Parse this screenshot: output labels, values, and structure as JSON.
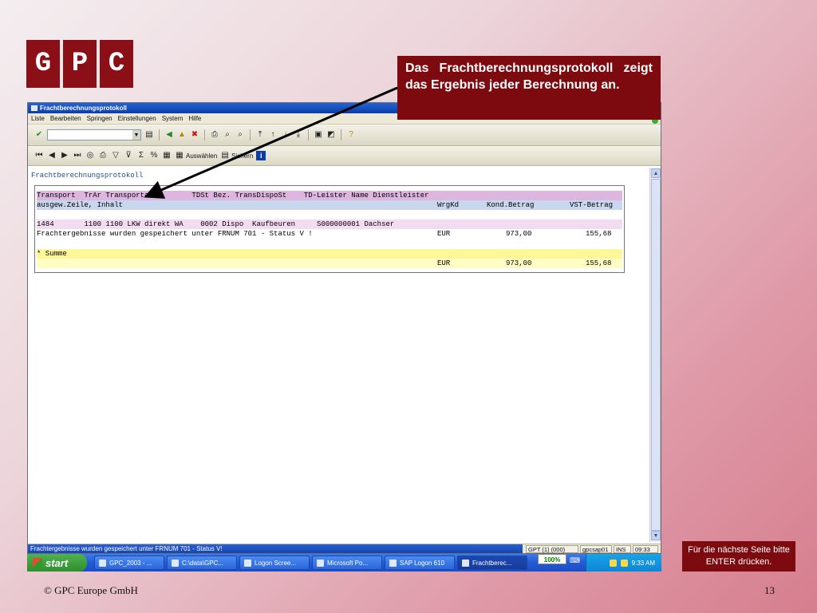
{
  "logo": {
    "letters": [
      "G",
      "P",
      "C"
    ]
  },
  "callout": {
    "text": "Das Frachtberechnungsprotokoll zeigt das Ergebnis jeder Berechnung an."
  },
  "window": {
    "title": "Frachtberechnungsprotokoll",
    "menu": [
      "Liste",
      "Bearbeiten",
      "Springen",
      "Einstellungen",
      "System",
      "Hilfe"
    ],
    "toolbar2": {
      "auswaehlen": "Auswählen",
      "sichern": "Sichern"
    }
  },
  "report": {
    "title": "Frachtberechnungsprotokoll",
    "header": {
      "line1": "Transport  TrAr Transportart        TDSt Bez. TransDispoSt    TD-Leister Name Dienstleister",
      "line2_left": "ausgew.Zeile, Inhalt",
      "wrgkd": "WrgKd",
      "kond": "Kond.Betrag",
      "vst": "VST-Betrag"
    },
    "detail": {
      "line1": "1484       1100 1100 LKW direkt WA    0002 Dispo  Kaufbeuren     S000000001 Dachser",
      "line2_left": "Frachtergebnisse wurden gespeichert unter FRNUM 701 - Status V !",
      "wrgkd": "EUR",
      "kond": "973,00",
      "vst": "155,68"
    },
    "summe": {
      "label": "* Summe",
      "wrgkd": "EUR",
      "kond": "973,00",
      "vst": "155,68"
    }
  },
  "statusbar": {
    "message": "Frachtergebnisse wurden gespeichert unter FRNUM 701 - Status V!",
    "system": "GPT (1) (000)",
    "server": "gpcsap01",
    "mode": "INS",
    "time": "09:33"
  },
  "taskbar": {
    "start": "start",
    "tasks": [
      "GPC_2003 - ...",
      "C:\\data\\GPC...",
      "Logon Scree...",
      "Microsoft Po...",
      "SAP Logon 610",
      "Frachtberec..."
    ],
    "zoom": "100%",
    "clock": "9:33 AM"
  },
  "note": {
    "text": "Für die nächste Seite bitte ENTER drücken."
  },
  "footer": {
    "copyright": "© GPC Europe GmbH",
    "page": "13"
  }
}
